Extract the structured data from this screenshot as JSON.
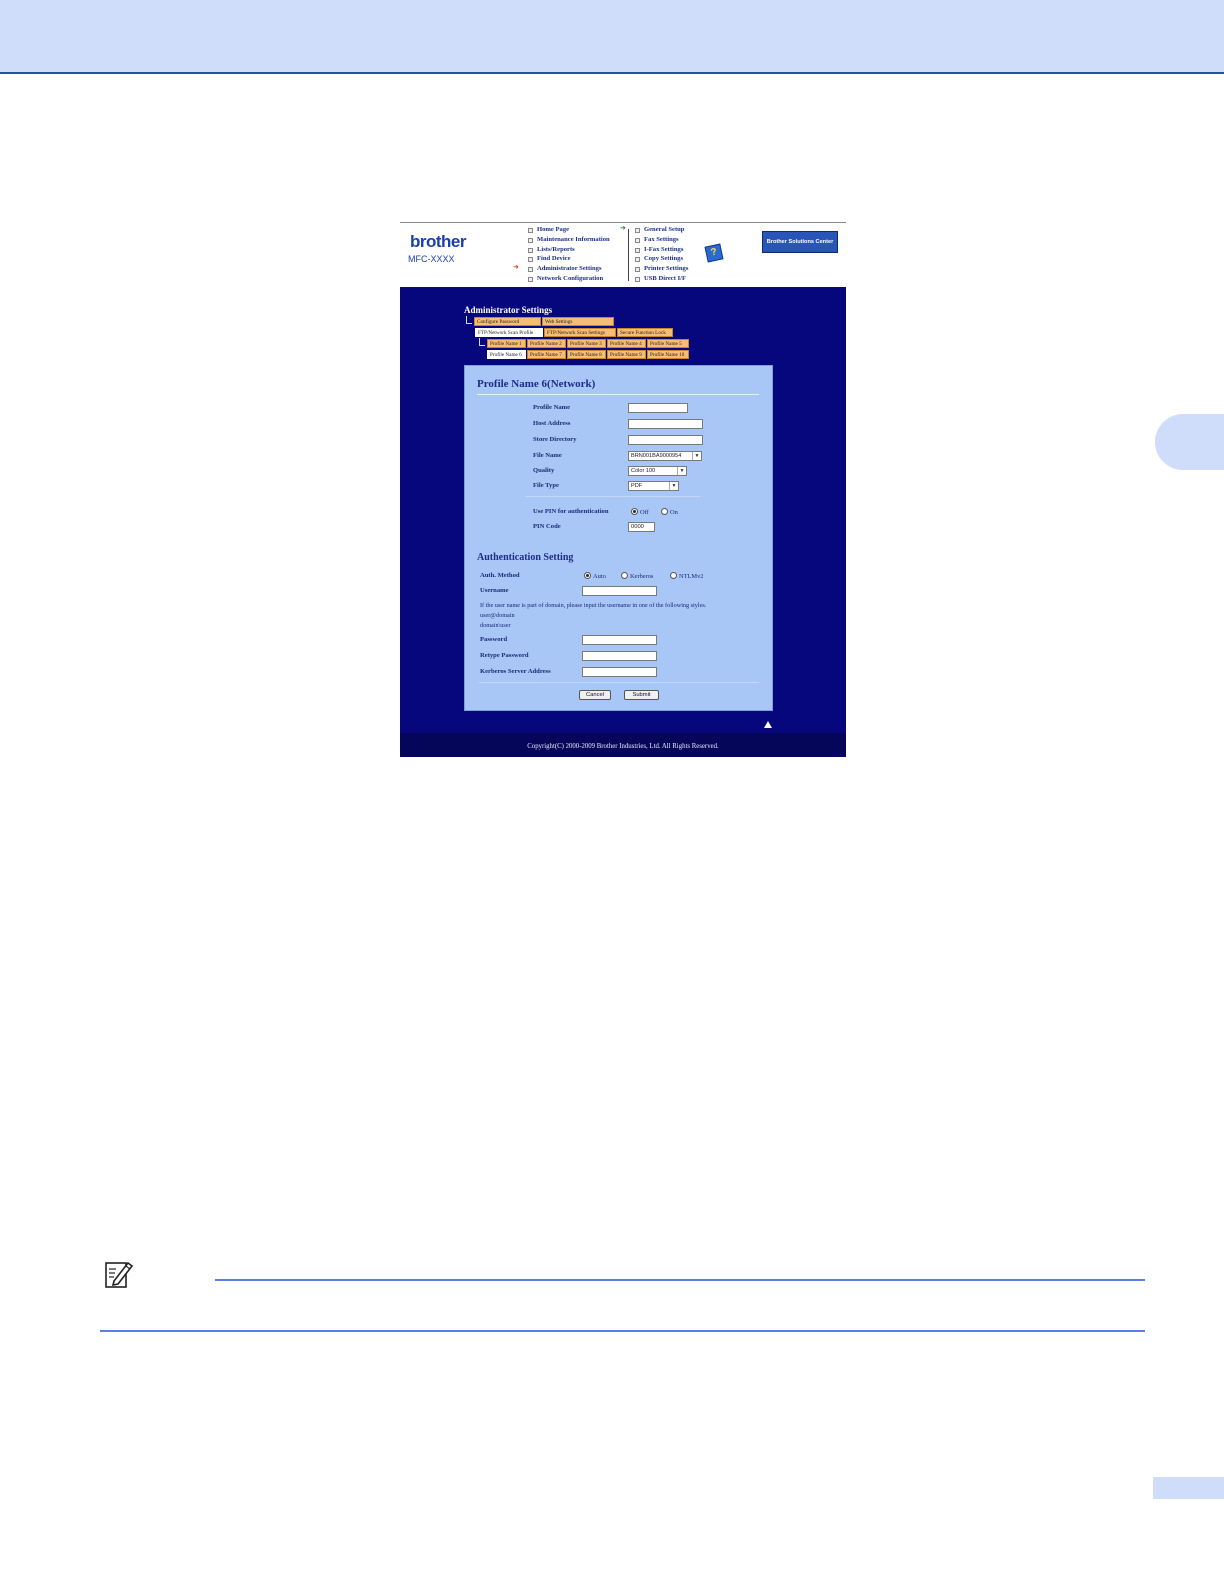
{
  "header": {
    "logo": "brother",
    "model": "MFC-XXXX",
    "nav_left": [
      "Home Page",
      "Maintenance Information",
      "Lists/Reports",
      "Find Device",
      "Administrator Settings",
      "Network Configuration"
    ],
    "nav_right": [
      "General Setup",
      "Fax Settings",
      "I-Fax Settings",
      "Copy Settings",
      "Printer Settings",
      "USB Direct I/F"
    ],
    "solutions_button": "Brother Solutions Center",
    "help_icon": "?"
  },
  "admin": {
    "title": "Administrator Settings",
    "tabs_row1": [
      "Configure Password",
      "Web Settings"
    ],
    "tabs_row2": [
      "FTP/Network Scan Profile",
      "FTP/Network Scan Settings",
      "Secure Function Lock"
    ],
    "profiles_row1": [
      "Profile Name 1",
      "Profile Name 2",
      "Profile Name 3",
      "Profile Name 4",
      "Profile Name 5"
    ],
    "profiles_row2": [
      "Profile Name 6",
      "Profile Name 7",
      "Profile Name 8",
      "Profile Name 9",
      "Profile Name 10"
    ]
  },
  "form": {
    "title": "Profile Name 6(Network)",
    "profile_name_label": "Profile Name",
    "profile_name_value": "",
    "host_address_label": "Host Address",
    "host_address_value": "",
    "store_directory_label": "Store Directory",
    "store_directory_value": "",
    "file_name_label": "File Name",
    "file_name_value": "BRN001BA9000954",
    "quality_label": "Quality",
    "quality_value": "Color 100",
    "file_type_label": "File Type",
    "file_type_value": "PDF",
    "use_pin_label": "Use PIN for authentication",
    "pin_off": "Off",
    "pin_on": "On",
    "pin_code_label": "PIN Code",
    "pin_code_value": "0000"
  },
  "auth": {
    "title": "Authentication Setting",
    "method_label": "Auth. Method",
    "method_auto": "Auto",
    "method_kerberos": "Kerberos",
    "method_ntlm": "NTLMv2",
    "username_label": "Username",
    "username_value": "",
    "hint": "If the user name is part of domain, please input the username in one of the following styles.",
    "hint_style1": "user@domain",
    "hint_style2": "domain\\user",
    "password_label": "Password",
    "retype_label": "Retype Password",
    "kerberos_label": "Kerberos Server Address",
    "cancel": "Cancel",
    "submit": "Submit"
  },
  "footer": {
    "copyright": "Copyright(C) 2000-2009 Brother Industries, Ltd. All Rights Reserved."
  },
  "colors": {
    "band": "#cfddfb",
    "page_blue": "#07077d",
    "panel": "#a8c6f6",
    "tab_orange": "#f7bd72",
    "rule": "#5a7fe0"
  }
}
